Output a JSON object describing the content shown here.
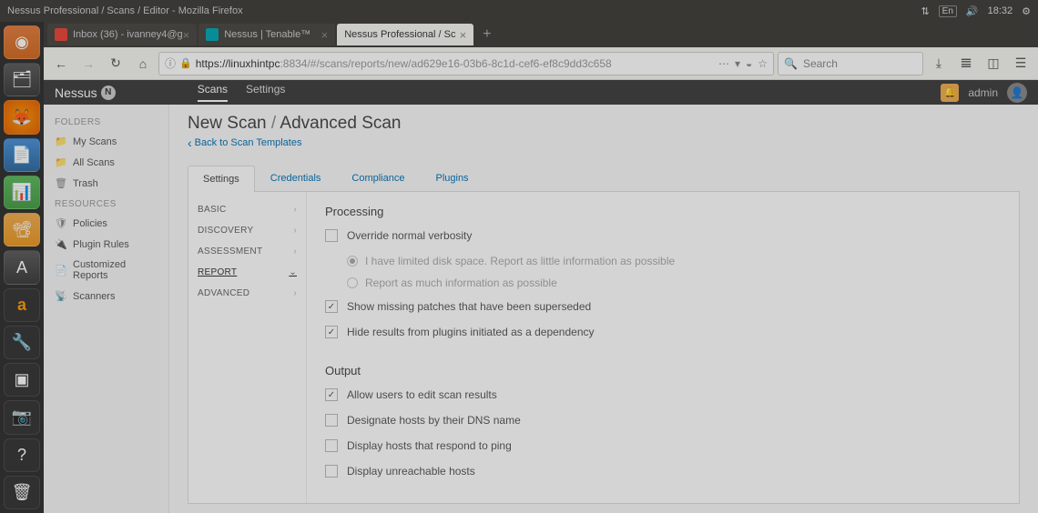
{
  "window": {
    "title": "Nessus Professional / Scans / Editor - Mozilla Firefox",
    "indicators": {
      "lang": "En",
      "time": "18:32"
    }
  },
  "firefox": {
    "tabs": [
      {
        "label": "Inbox (36) - ivanney4@g"
      },
      {
        "label": "Nessus | Tenable™"
      },
      {
        "label": "Nessus Professional / Sc"
      }
    ],
    "url": {
      "scheme_host": "https://linuxhintpc",
      "port_path": ":8834/#/scans/reports/new/ad629e16-03b6-8c1d-cef6-ef8c9dd3c658"
    },
    "search_placeholder": "Search"
  },
  "nessus": {
    "brand": "Nessus",
    "topnav": {
      "scans": "Scans",
      "settings": "Settings"
    },
    "user": "admin",
    "sidebar": {
      "folders_label": "FOLDERS",
      "folders": [
        {
          "label": "My Scans"
        },
        {
          "label": "All Scans"
        },
        {
          "label": "Trash"
        }
      ],
      "resources_label": "RESOURCES",
      "resources": [
        {
          "label": "Policies"
        },
        {
          "label": "Plugin Rules"
        },
        {
          "label": "Customized Reports"
        },
        {
          "label": "Scanners"
        }
      ]
    },
    "page": {
      "title_a": "New Scan",
      "title_b": "Advanced Scan",
      "back": "Back to Scan Templates"
    },
    "tabs": {
      "settings": "Settings",
      "credentials": "Credentials",
      "compliance": "Compliance",
      "plugins": "Plugins"
    },
    "categories": {
      "basic": "BASIC",
      "discovery": "DISCOVERY",
      "assessment": "ASSESSMENT",
      "report": "REPORT",
      "advanced": "ADVANCED"
    },
    "form": {
      "processing_header": "Processing",
      "override": "Override normal verbosity",
      "r1": "I have limited disk space. Report as little information as possible",
      "r2": "Report as much information as possible",
      "missing_patches": "Show missing patches that have been superseded",
      "hide_deps": "Hide results from plugins initiated as a dependency",
      "output_header": "Output",
      "allow_edit": "Allow users to edit scan results",
      "dns_name": "Designate hosts by their DNS name",
      "respond_ping": "Display hosts that respond to ping",
      "unreachable": "Display unreachable hosts"
    }
  }
}
